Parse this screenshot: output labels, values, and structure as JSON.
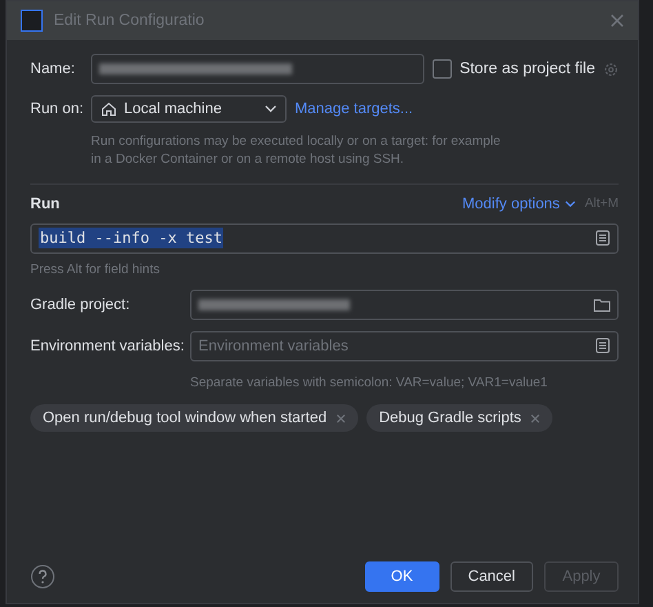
{
  "window": {
    "title": "Edit Run Configuratio"
  },
  "name_field": {
    "label": "Name:"
  },
  "store_as_project_file": {
    "label": "Store as project file",
    "checked": false
  },
  "run_on": {
    "label": "Run on:",
    "value": "Local machine",
    "link": "Manage targets...",
    "hint": "Run configurations may be executed locally or on a target: for example in a Docker Container or on a remote host using SSH."
  },
  "run_section": {
    "title": "Run",
    "modify_options": "Modify options",
    "shortcut": "Alt+M",
    "command": "build --info -x test",
    "hint": "Press Alt for field hints"
  },
  "gradle_project": {
    "label": "Gradle project:"
  },
  "environment_variables": {
    "label": "Environment variables:",
    "placeholder": "Environment variables",
    "hint": "Separate variables with semicolon: VAR=value; VAR1=value1"
  },
  "tags": [
    {
      "label": "Open run/debug tool window when started"
    },
    {
      "label": "Debug Gradle scripts"
    }
  ],
  "buttons": [
    {
      "label": "OK",
      "kind": "primary",
      "disabled": false
    },
    {
      "label": "Cancel",
      "kind": "secondary",
      "disabled": false
    },
    {
      "label": "Apply",
      "kind": "secondary",
      "disabled": true
    }
  ]
}
